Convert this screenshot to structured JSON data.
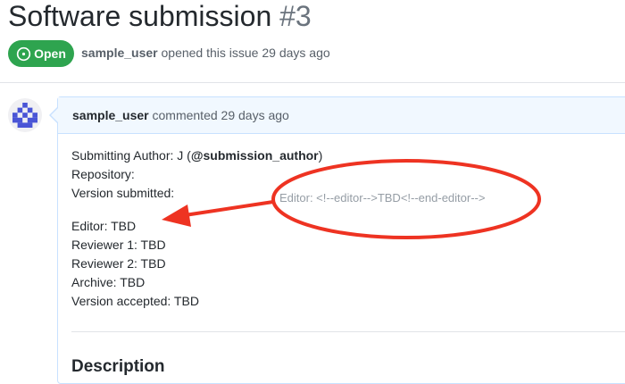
{
  "issue": {
    "title": "Software submission",
    "number": "#3",
    "status_badge": "Open",
    "author": "sample_user",
    "opened_text": "opened this issue 29 days ago"
  },
  "comment": {
    "author": "sample_user",
    "commented_text": "commented 29 days ago",
    "submitting_author_prefix": "Submitting Author: J (",
    "submitting_author_handle": "@submission_author",
    "submitting_author_suffix": ")",
    "repository": "Repository:",
    "version_submitted": "Version submitted:",
    "editor_hint": "Editor: <!--editor-->TBD<!--end-editor-->",
    "editor": "Editor: TBD",
    "reviewer_1": "Reviewer 1: TBD",
    "reviewer_2": "Reviewer 2: TBD",
    "archive": "Archive: TBD",
    "version_accepted": "Version accepted: TBD",
    "description_heading": "Description"
  },
  "colors": {
    "open_green": "#2ea44f",
    "annotation_red": "#ee3322",
    "comment_header_bg": "#f1f8ff",
    "avatar_blue": "#4a55d6"
  },
  "icons": {
    "status": "issue-opened-icon",
    "avatar": "identicon"
  }
}
